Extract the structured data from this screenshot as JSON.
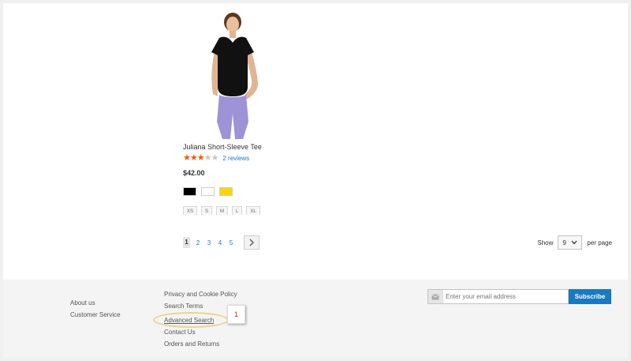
{
  "product": {
    "image": "juliana-short-sleeve-tee-photo",
    "name": "Juliana Short-Sleeve Tee",
    "rating": {
      "stars": 3,
      "max": 5
    },
    "reviews_label": "2 reviews",
    "price": "$42.00",
    "colors": [
      {
        "name": "Black",
        "hex": "#000000"
      },
      {
        "name": "White",
        "hex": "#ffffff"
      },
      {
        "name": "Yellow",
        "hex": "#ffd500"
      }
    ],
    "sizes": [
      "XS",
      "S",
      "M",
      "L",
      "XL"
    ]
  },
  "pager": {
    "pages": [
      "1",
      "2",
      "3",
      "4",
      "5"
    ],
    "current_page": "1",
    "next_icon": "chevron-right-icon"
  },
  "limiter": {
    "show_label": "Show",
    "value": "9",
    "per_page_label": "per page"
  },
  "footer": {
    "col1": [
      "About us",
      "Customer Service"
    ],
    "col2": [
      "Privacy and Cookie Policy",
      "Search Terms",
      "Advanced Search",
      "Contact Us",
      "Orders and Returns"
    ],
    "newsletter": {
      "placeholder": "Enter your email address",
      "button_label": "Subscribe",
      "icon": "envelope-icon"
    },
    "annotation_label": "1"
  },
  "colors": {
    "accent": "#1979c3",
    "star_on": "#ff5501",
    "star_off": "#c7c7c7",
    "annotation_red": "#d1231b",
    "highlight": "#e9d38c"
  }
}
